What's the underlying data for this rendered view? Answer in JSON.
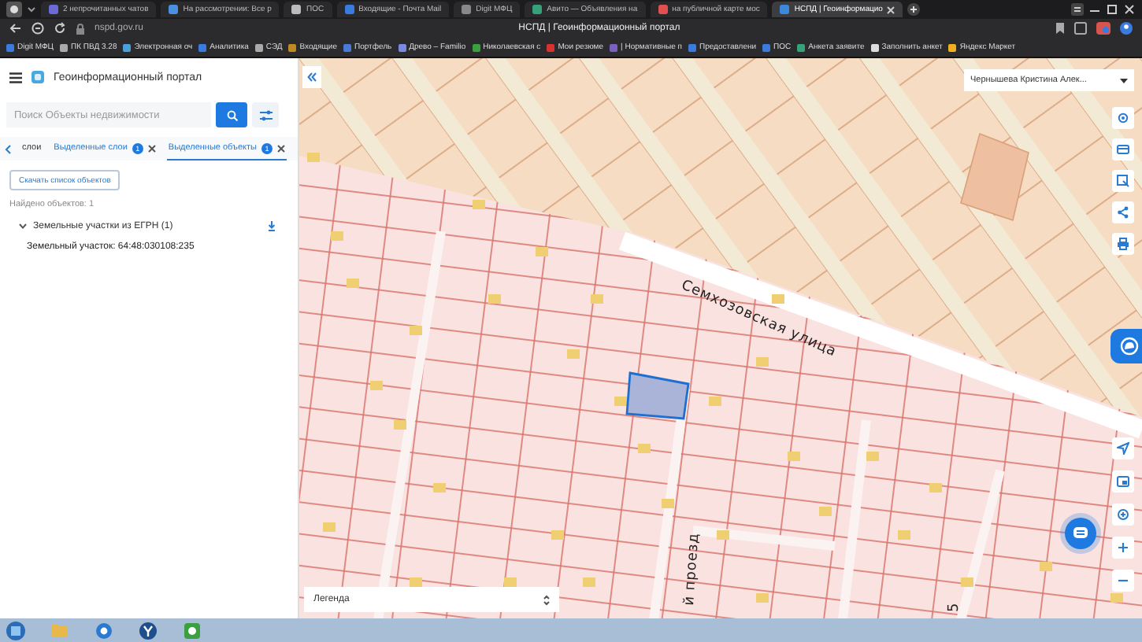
{
  "browser": {
    "tabs": [
      {
        "label": "2 непрочитанных чатов",
        "selected": false
      },
      {
        "label": "На рассмотрении: Все р",
        "selected": false
      },
      {
        "label": "ПОС",
        "selected": false
      },
      {
        "label": "Входящие - Почта Mail",
        "selected": false
      },
      {
        "label": "Digit МФЦ",
        "selected": false
      },
      {
        "label": "Авито — Объявления на",
        "selected": false
      },
      {
        "label": "на публичной карте мос",
        "selected": false
      },
      {
        "label": "НСПД | Геоинформацио",
        "selected": true
      }
    ],
    "address": "nspd.gov.ru",
    "page_title": "НСПД | Геоинформационный портал",
    "bookmarks": [
      "Digit МФЦ",
      "ПК ПВД 3.28",
      "Электронная оч",
      "Аналитика",
      "СЭД",
      "Входящие",
      "Портфель",
      "Древо – Familio",
      "Николаевская с",
      "Мои резюме",
      "| Нормативные п",
      "Предоставлени",
      "ПОС",
      "Анкета заявите",
      "Заполнить анкет",
      "Яндекс Маркет"
    ]
  },
  "sidebar": {
    "title": "Геоинформационный портал",
    "search": {
      "placeholder": "Поиск Объекты недвижимости"
    },
    "tabs": [
      {
        "label": "слои",
        "selected": false
      },
      {
        "label": "Выделенные слои",
        "badge": "1",
        "selected": false
      },
      {
        "label": "Выделенные объекты",
        "badge": "1",
        "selected": true
      }
    ],
    "download_button": "Скачать список объектов",
    "found": "Найдено объектов: 1",
    "groups": [
      {
        "label": "Земельные участки из ЕГРН (1)",
        "expanded": true,
        "items": [
          "Земельный участок: 64:48:030108:235"
        ]
      }
    ]
  },
  "map": {
    "user": "Чернышева Кристина Алек...",
    "street_labels": [
      "Семхозовская улица",
      "й проезд",
      "5"
    ],
    "legend": "Легенда"
  }
}
